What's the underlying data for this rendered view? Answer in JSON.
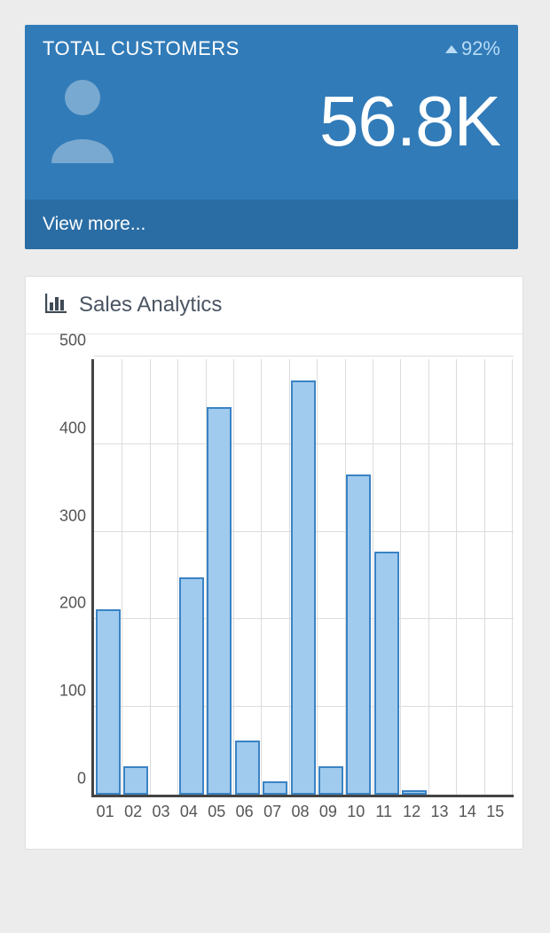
{
  "stat_card": {
    "title": "TOTAL CUSTOMERS",
    "change": "92%",
    "value": "56.8K",
    "footer": "View more..."
  },
  "panel": {
    "title": "Sales Analytics"
  },
  "chart_data": {
    "type": "bar",
    "title": "Sales Analytics",
    "xlabel": "",
    "ylabel": "",
    "ylim": [
      0,
      500
    ],
    "y_ticks": [
      0,
      100,
      200,
      300,
      400,
      500
    ],
    "categories": [
      "01",
      "02",
      "03",
      "04",
      "05",
      "06",
      "07",
      "08",
      "09",
      "10",
      "11",
      "12",
      "13",
      "14",
      "15"
    ],
    "values": [
      212,
      32,
      0,
      248,
      442,
      62,
      15,
      473,
      32,
      365,
      277,
      5,
      0,
      0,
      0
    ]
  }
}
